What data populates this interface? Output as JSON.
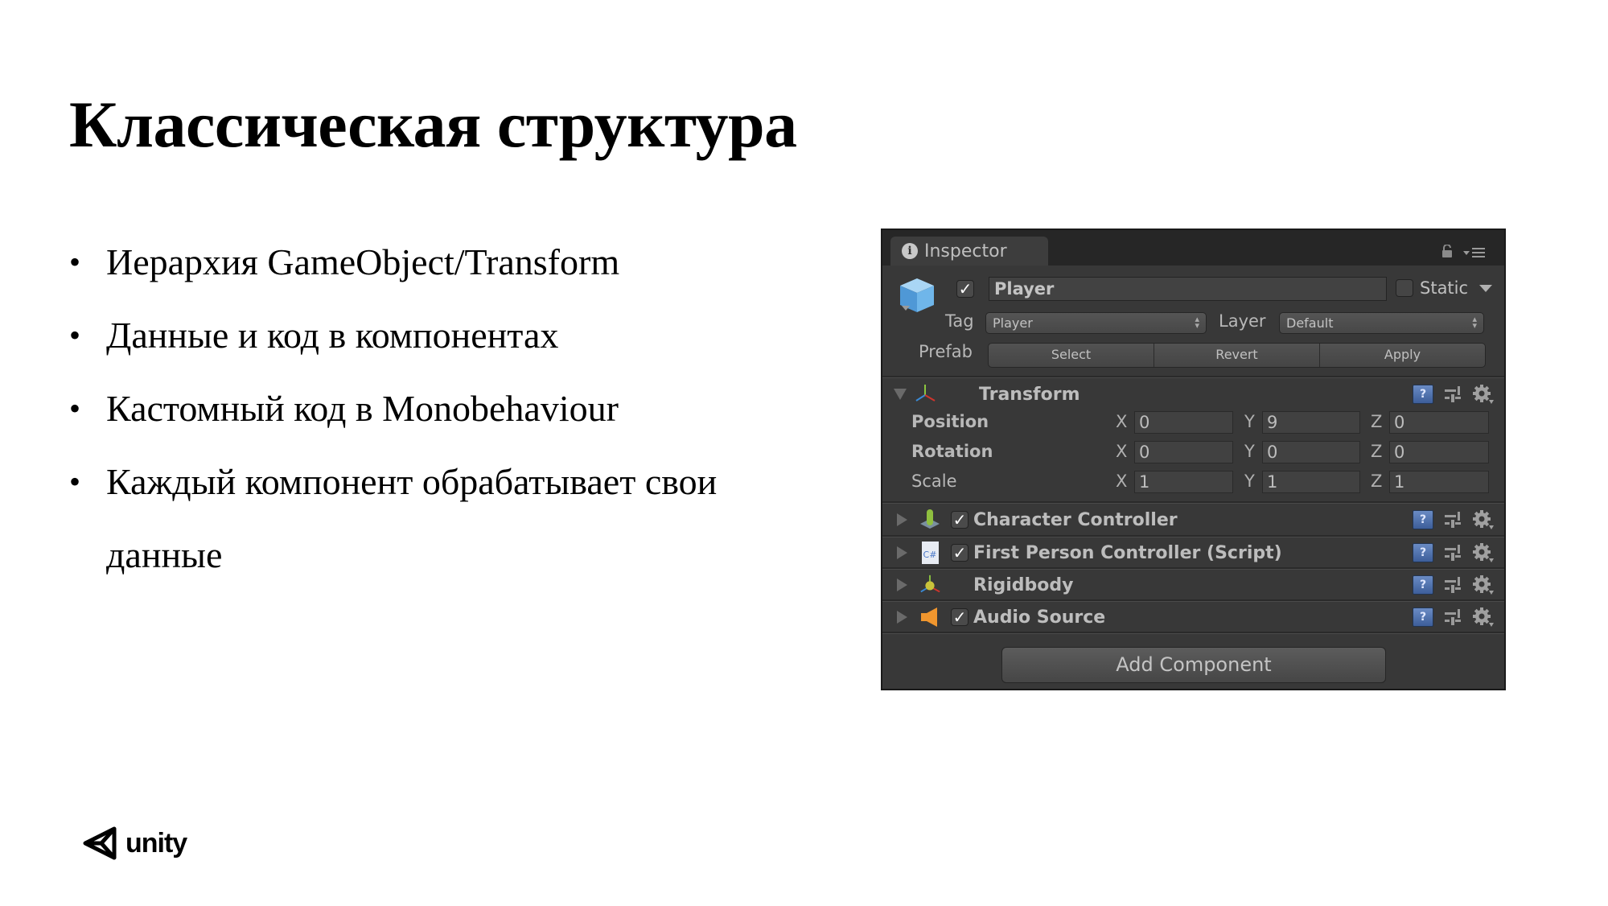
{
  "slide": {
    "title": "Классическая структура",
    "bullets": [
      "Иерархия GameObject/Transform",
      "Данные и код в компонентах",
      "Кастомный код в Monobehaviour",
      "Каждый компонент обрабатывает свои данные"
    ],
    "bullet_symbol": "•",
    "logo_text": "unity"
  },
  "inspector": {
    "tab_label": "Inspector",
    "info_glyph": "i",
    "object_active": true,
    "object_name": "Player",
    "static_checked": false,
    "static_label": "Static",
    "tag_label": "Tag",
    "tag_value": "Player",
    "layer_label": "Layer",
    "layer_value": "Default",
    "prefab_label": "Prefab",
    "prefab_buttons": [
      "Select",
      "Revert",
      "Apply"
    ],
    "transform": {
      "title": "Transform",
      "rows": [
        {
          "label": "Position",
          "x": "0",
          "y": "9",
          "z": "0",
          "modified": true
        },
        {
          "label": "Rotation",
          "x": "0",
          "y": "0",
          "z": "0",
          "modified": true
        },
        {
          "label": "Scale",
          "x": "1",
          "y": "1",
          "z": "1",
          "modified": false
        }
      ],
      "axis_labels": [
        "X",
        "Y",
        "Z"
      ]
    },
    "components": [
      {
        "name": "Character Controller",
        "icon": "character-controller-icon",
        "has_checkbox": true,
        "enabled": true
      },
      {
        "name": "First Person Controller (Script)",
        "icon": "csharp-script-icon",
        "has_checkbox": true,
        "enabled": true
      },
      {
        "name": "Rigidbody",
        "icon": "rigidbody-icon",
        "has_checkbox": false,
        "enabled": true
      },
      {
        "name": "Audio Source",
        "icon": "audio-source-icon",
        "has_checkbox": true,
        "enabled": true
      }
    ],
    "help_glyph": "?",
    "checkmark_glyph": "✓",
    "script_icon_text": "C#",
    "add_component_label": "Add Component",
    "colors": {
      "panel_bg": "#383838",
      "header_bg": "#262626",
      "text": "#bdbdbd",
      "help_icon": "#4f6fae",
      "audio_icon": "#f0962e",
      "cube_icon": "#5aa6e0"
    }
  }
}
